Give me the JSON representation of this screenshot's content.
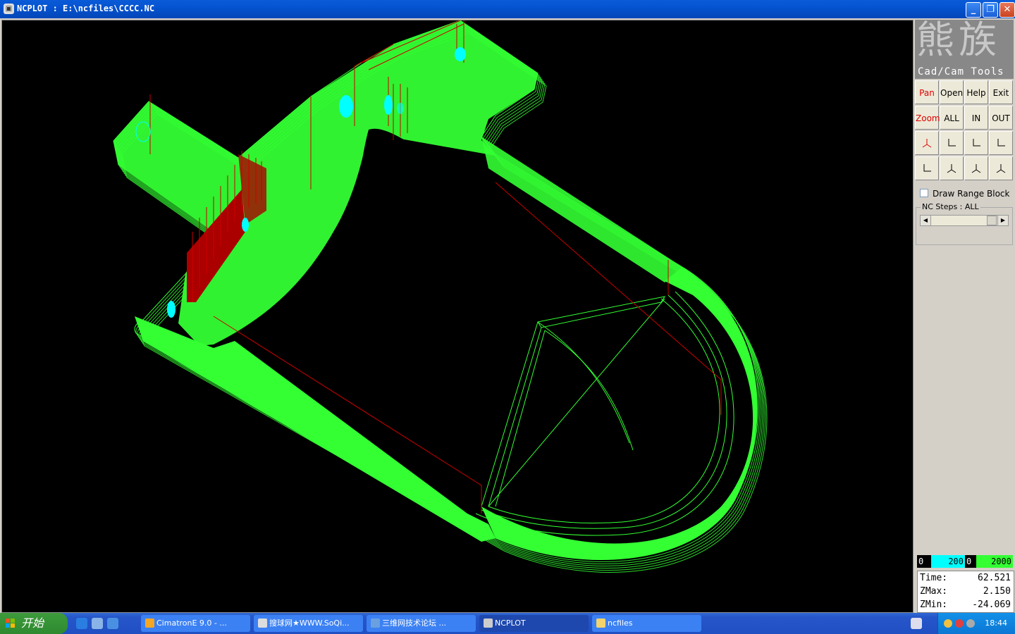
{
  "window": {
    "title": "NCPLOT : E:\\ncfiles\\CCCC.NC",
    "controls": [
      "minimize",
      "restore",
      "close"
    ]
  },
  "panel": {
    "logo_text": "熊族",
    "logo_sub": "Cad/Cam Tools",
    "buttons_row1": [
      "Pan",
      "Open",
      "Help",
      "Exit"
    ],
    "buttons_row2": [
      "Zoom",
      "ALL",
      "IN",
      "OUT"
    ],
    "view_icons_row3": [
      "view-iso-icon",
      "view-xz-icon",
      "view-zx-icon",
      "view-zy-icon"
    ],
    "view_icons_row4": [
      "view-yx-icon",
      "view-xyz-icon",
      "view-yxz-icon",
      "view-yzx-icon"
    ],
    "draw_range_label": "Draw Range Block",
    "nc_steps_label": "NC Steps : ALL",
    "scale": {
      "a_min": "0",
      "a_max": "200",
      "b_min": "0",
      "b_max": "2000"
    },
    "stats": {
      "time_label": "Time:",
      "time_value": "62.521",
      "zmax_label": "ZMax:",
      "zmax_value": "2.150",
      "zmin_label": "ZMin:",
      "zmin_value": "-24.069"
    }
  },
  "colors": {
    "toolpath": "#33ff33",
    "rapid": "#cc0000",
    "plunge": "#00ffff",
    "background": "#000000"
  },
  "taskbar": {
    "start_label": "开始",
    "tasks": [
      "CimatronE 9.0 - ...",
      "搜球网★WWW.SoQi...",
      "三维网技术论坛 ...",
      "NCPLOT",
      "ncfiles"
    ],
    "active_task": "NCPLOT",
    "clock": "18:44"
  }
}
